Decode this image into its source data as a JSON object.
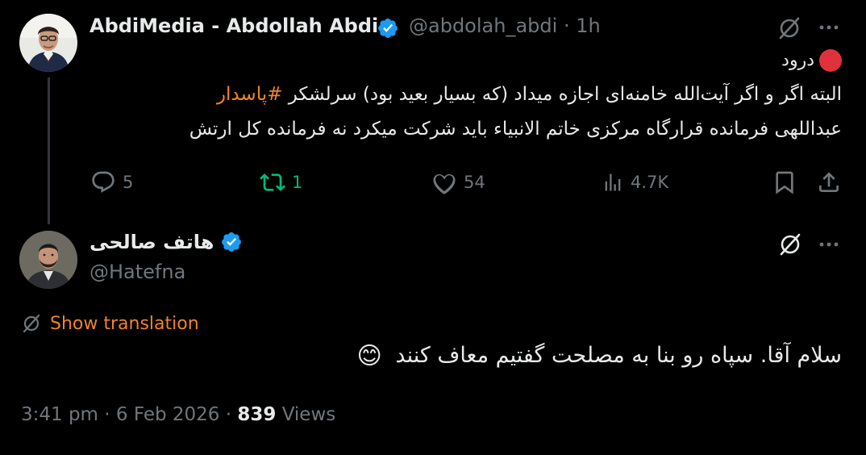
{
  "parent_tweet": {
    "display_name": "AbdiMedia - Abdollah Abdi",
    "handle": "@abdolah_abdi",
    "separator": "·",
    "time_ago": "1h",
    "reply_label": "درود",
    "status_dot_color": "#e0323c",
    "body_line1_prefix": "البته اگر و اگر آیت‌الله خامنه‌ای اجازه میداد (که بسیار بعید بود) سرلشکر ",
    "body_hashtag": "#پاسدار",
    "body_line2": "عبداللهی فرمانده قرارگاه مرکزی خاتم الانبیاء باید شرکت میکرد نه فرمانده کل ارتش",
    "actions": {
      "replies": "5",
      "reposts": "1",
      "likes": "54",
      "views": "4.7K"
    },
    "icons": [
      "verified-badge-icon",
      "grok-icon",
      "more-icon",
      "reply-icon",
      "repost-icon",
      "like-icon",
      "views-icon",
      "bookmark-icon",
      "share-icon"
    ]
  },
  "main_tweet": {
    "display_name": "هاتف صالحی",
    "handle": "@Hatefna",
    "show_translation": "Show translation",
    "body": "سلام آقا. سپاه رو بنا به مصلحت گفتیم معاف کنند",
    "emoji": "😊",
    "time": "3:41 pm",
    "separator": "·",
    "date": "6 Feb 2026",
    "views_count": "839",
    "views_label": "Views"
  },
  "colors": {
    "background": "#000000",
    "text": "#e7e9ea",
    "muted": "#71767b",
    "accent_orange": "#f0832b",
    "verified_blue": "#1d9bf0",
    "repost_green": "#00ba7c"
  }
}
